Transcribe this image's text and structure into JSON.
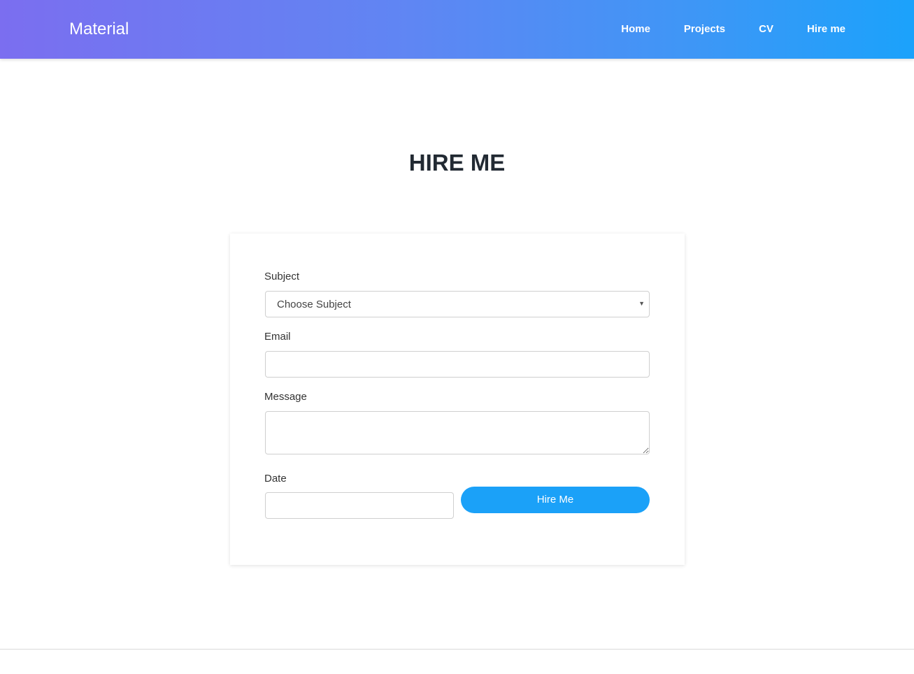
{
  "navbar": {
    "brand": "Material",
    "links": [
      {
        "label": "Home"
      },
      {
        "label": "Projects"
      },
      {
        "label": "CV"
      },
      {
        "label": "Hire me"
      }
    ],
    "gradient_start": "#7b6ef0",
    "gradient_end": "#1ba2fb"
  },
  "page": {
    "title": "HIRE ME"
  },
  "form": {
    "subject_label": "Subject",
    "subject_selected": "Choose Subject",
    "email_label": "Email",
    "email_value": "",
    "message_label": "Message",
    "message_value": "",
    "date_label": "Date",
    "date_value": "",
    "submit_label": "Hire Me",
    "accent_color": "#1ba1f8"
  }
}
